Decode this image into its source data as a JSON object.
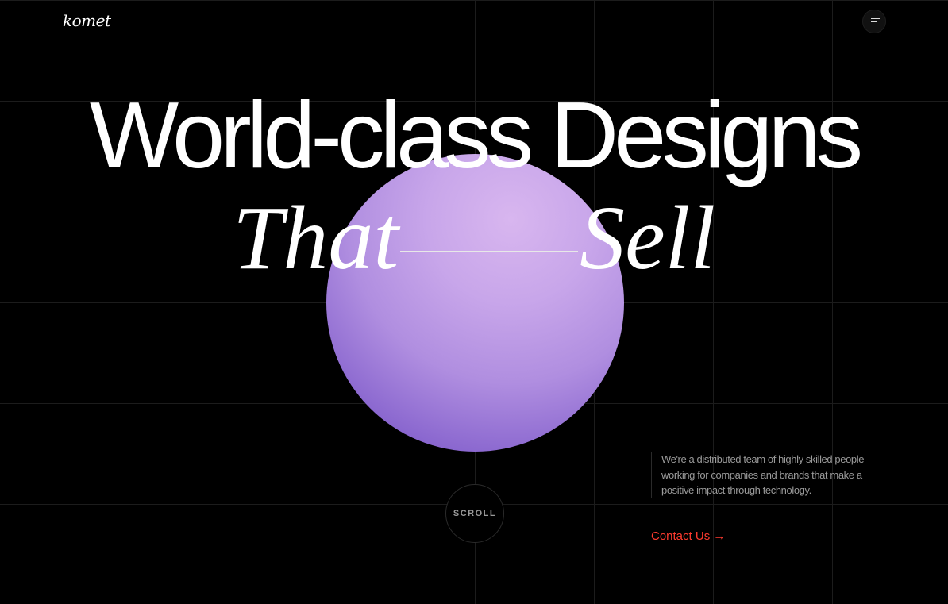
{
  "header": {
    "logo": "komet",
    "menu_icon": "hamburger-menu-icon"
  },
  "hero": {
    "headline_line1": "World-class Designs",
    "headline_line2_left": "That",
    "headline_line2_right": "Sell",
    "sphere_color": "#b08ee0"
  },
  "intro": {
    "description": "We're a distributed team of highly skilled people working for companies and brands that make a positive impact through technology.",
    "contact_label": "Contact Us →",
    "contact_color": "#ff3b2f"
  },
  "scroll": {
    "label": "SCROLL"
  }
}
